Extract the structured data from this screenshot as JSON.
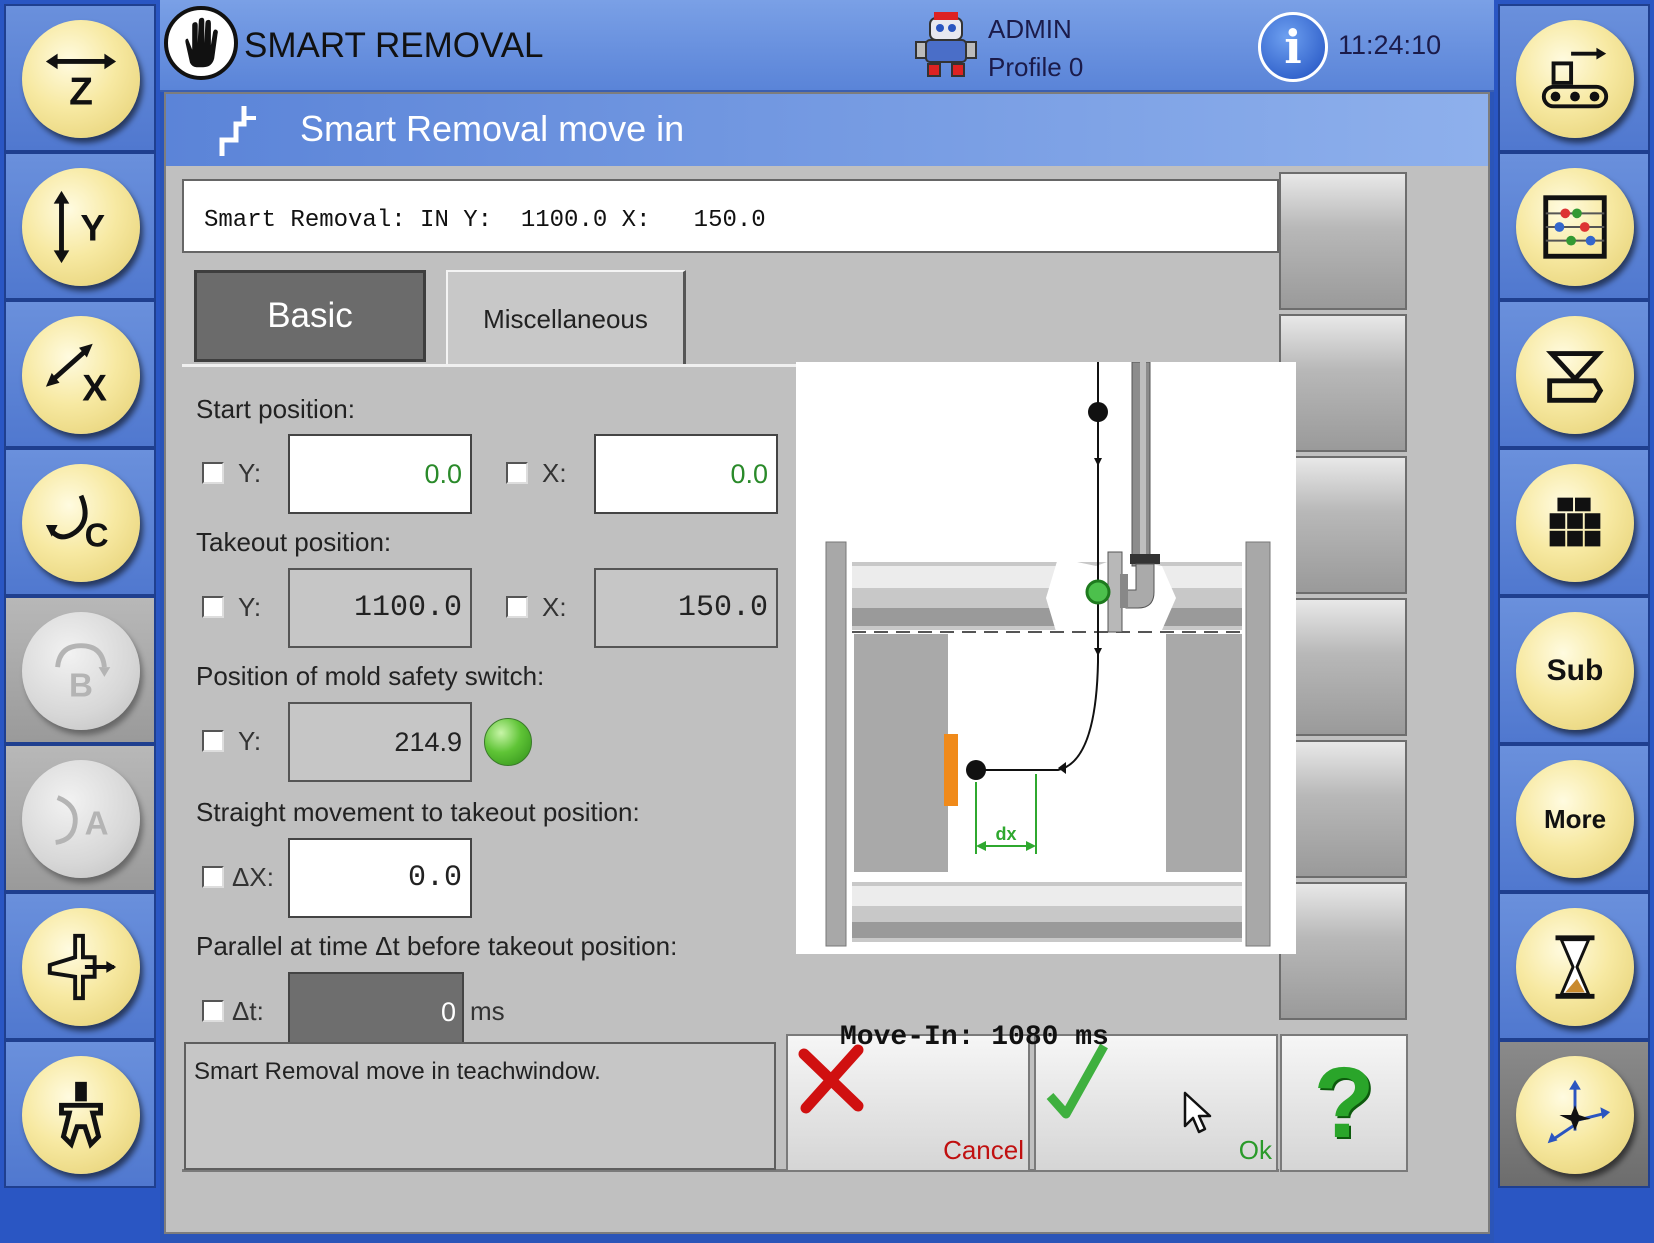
{
  "header": {
    "title": "SMART REMOVAL",
    "user_name": "ADMIN",
    "user_profile": "Profile 0",
    "time": "11:24:10"
  },
  "left_sidebar": {
    "items": [
      {
        "name": "z-axis",
        "label": "Z",
        "enabled": true
      },
      {
        "name": "y-axis",
        "label": "Y",
        "enabled": true
      },
      {
        "name": "x-axis",
        "label": "X",
        "enabled": true
      },
      {
        "name": "c-axis",
        "label": "C",
        "enabled": true
      },
      {
        "name": "b-axis",
        "label": "B",
        "enabled": false
      },
      {
        "name": "a-axis",
        "label": "A",
        "enabled": false
      },
      {
        "name": "ejector",
        "label": "",
        "enabled": true
      },
      {
        "name": "gripper",
        "label": "",
        "enabled": true
      }
    ]
  },
  "right_sidebar": {
    "items": [
      {
        "name": "conveyor",
        "label": ""
      },
      {
        "name": "counter",
        "label": ""
      },
      {
        "name": "mold",
        "label": ""
      },
      {
        "name": "stack",
        "label": ""
      },
      {
        "name": "sub",
        "label": "Sub"
      },
      {
        "name": "more",
        "label": "More"
      },
      {
        "name": "timer",
        "label": ""
      },
      {
        "name": "axes-home",
        "label": ""
      }
    ]
  },
  "dialog": {
    "title": "Smart Removal move in",
    "status_line": "Smart Removal: IN Y:  1100.0 X:   150.0",
    "tabs": [
      {
        "label": "Basic",
        "active": true
      },
      {
        "label": "Miscellaneous",
        "active": false
      }
    ],
    "start_position": {
      "label": "Start position:",
      "y_label": "Y:",
      "y_value": "0.0",
      "x_label": "X:",
      "x_value": "0.0"
    },
    "takeout_position": {
      "label": "Takeout position:",
      "y_label": "Y:",
      "y_value": "1100.0",
      "x_label": "X:",
      "x_value": "150.0"
    },
    "mold_safety": {
      "label": "Position of mold safety switch:",
      "y_label": "Y:",
      "y_value": "214.9"
    },
    "straight_movement": {
      "label": "Straight movement to takeout position:",
      "dx_label": "ΔX:",
      "dx_value": "0.0"
    },
    "parallel": {
      "label": "Parallel at time Δt before takeout position:",
      "dt_label": "Δt:",
      "dt_value": "0",
      "dt_unit": "ms"
    },
    "diagram": {
      "dx_label": "dx",
      "move_in": "Move-In: 1080 ms"
    },
    "message": "Smart Removal move in teachwindow.",
    "cancel_label": "Cancel",
    "ok_label": "Ok",
    "help_label": "?"
  },
  "colors": {
    "sidebar_blue": "#2a56c3",
    "button_yellow": "#f7e9a2",
    "cancel_red": "#cc1111",
    "ok_green": "#2aa52a",
    "led_green": "#5fc436"
  }
}
